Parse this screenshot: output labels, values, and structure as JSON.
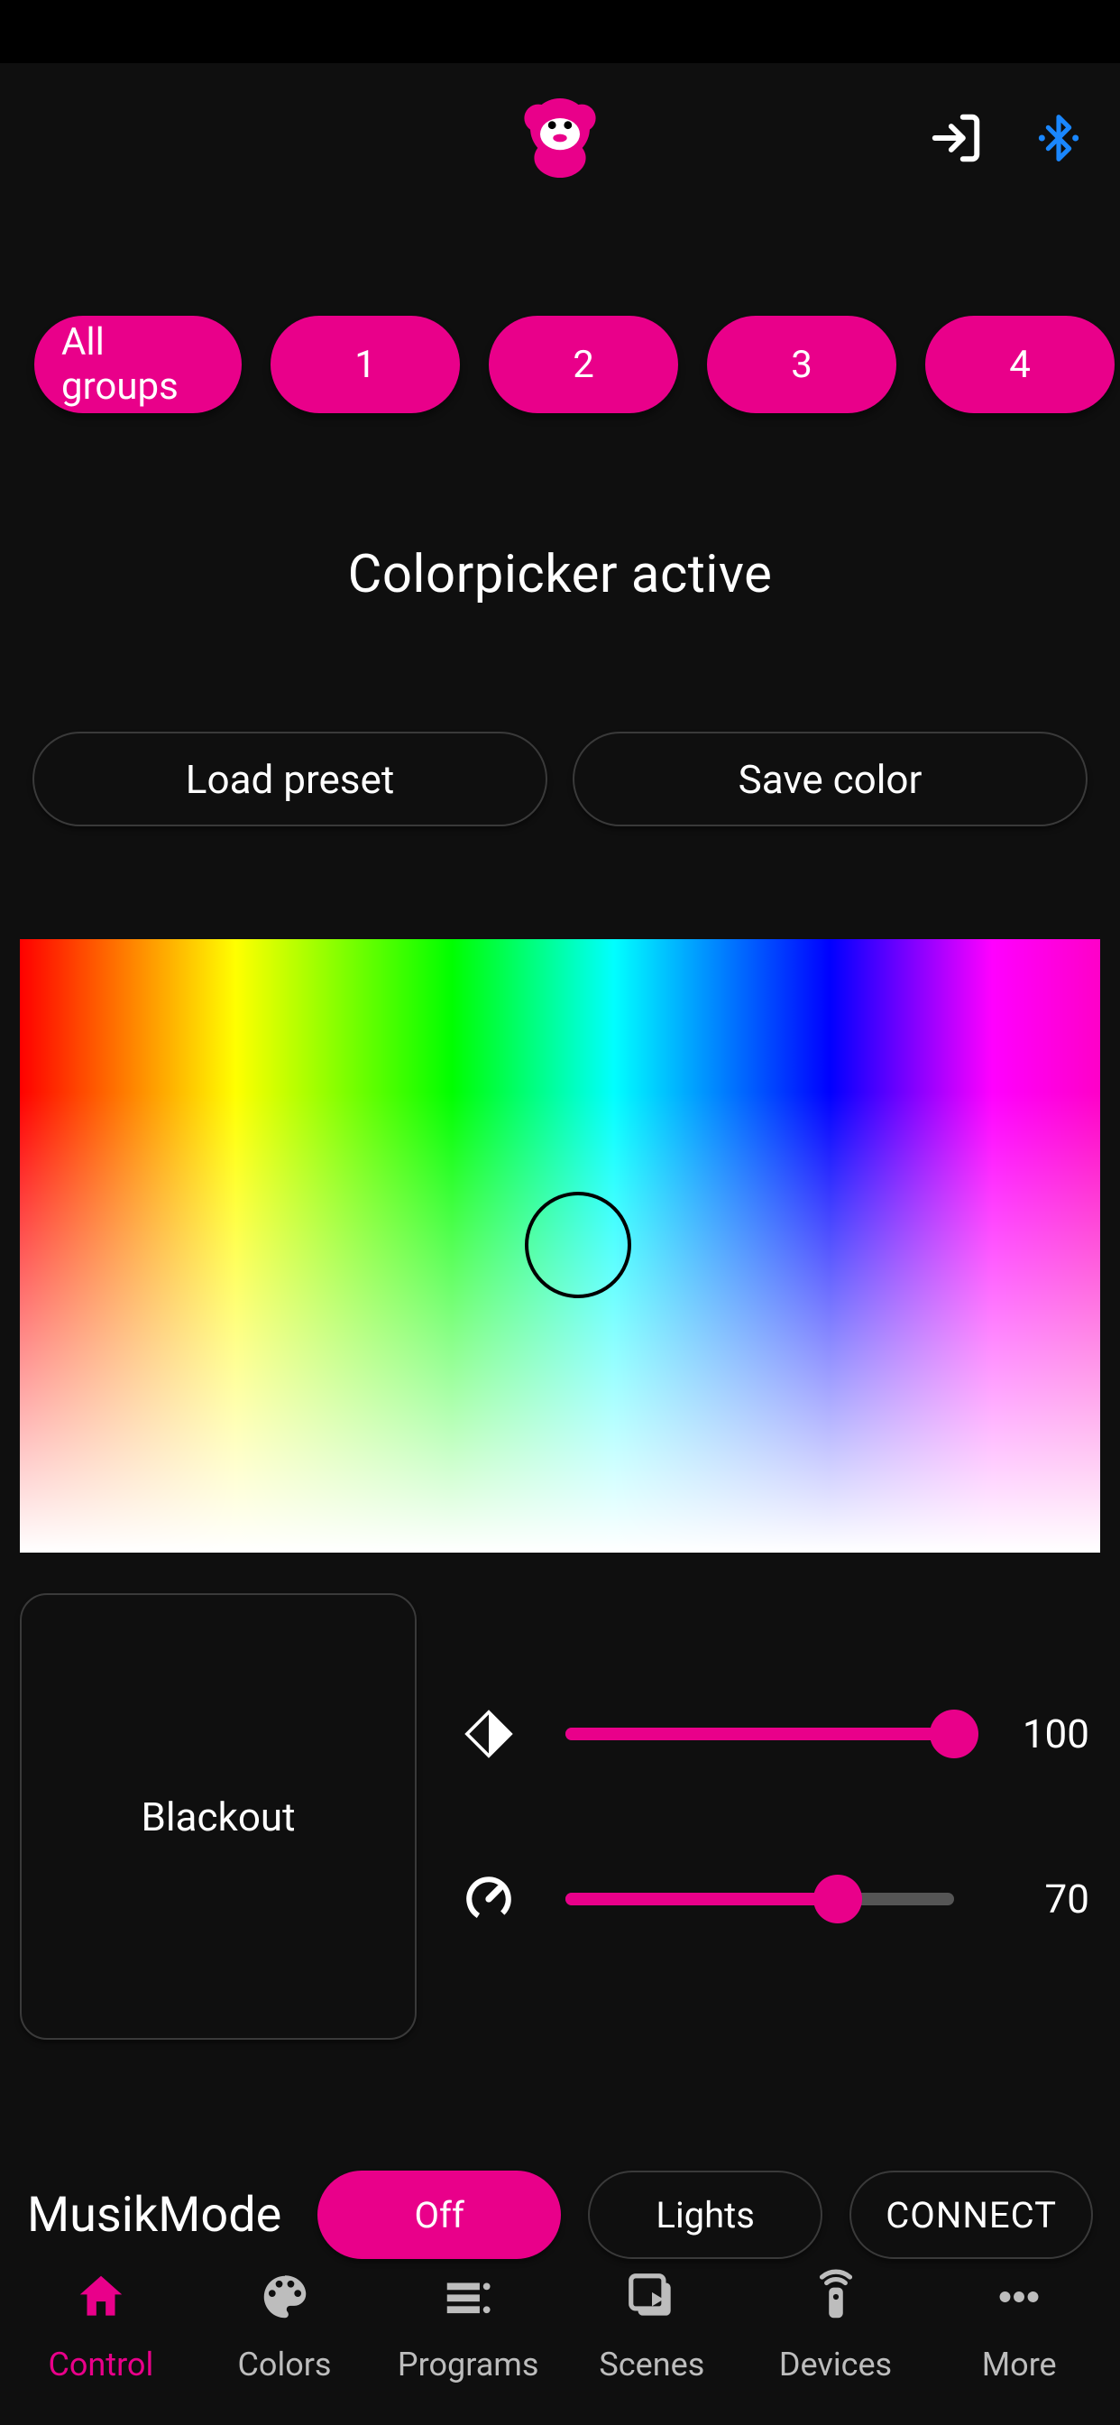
{
  "accent": "#e9008a",
  "header": {
    "logo_name": "monkey-logo",
    "login_icon": "login-icon",
    "bluetooth_icon": "bluetooth-icon"
  },
  "groups": {
    "all_label": "All groups",
    "items": [
      "1",
      "2",
      "3",
      "4"
    ]
  },
  "title": "Colorpicker active",
  "buttons": {
    "load_preset": "Load preset",
    "save_color": "Save color"
  },
  "blackout_label": "Blackout",
  "sliders": {
    "brightness": {
      "value": 100,
      "percent": 100
    },
    "speed": {
      "value": 70,
      "percent": 70
    }
  },
  "music": {
    "label": "MusikMode",
    "off": "Off",
    "lights": "Lights",
    "connect": "CONNECT",
    "active": "off"
  },
  "tabs": {
    "control": "Control",
    "colors": "Colors",
    "programs": "Programs",
    "scenes": "Scenes",
    "devices": "Devices",
    "more": "More",
    "active": "control"
  }
}
